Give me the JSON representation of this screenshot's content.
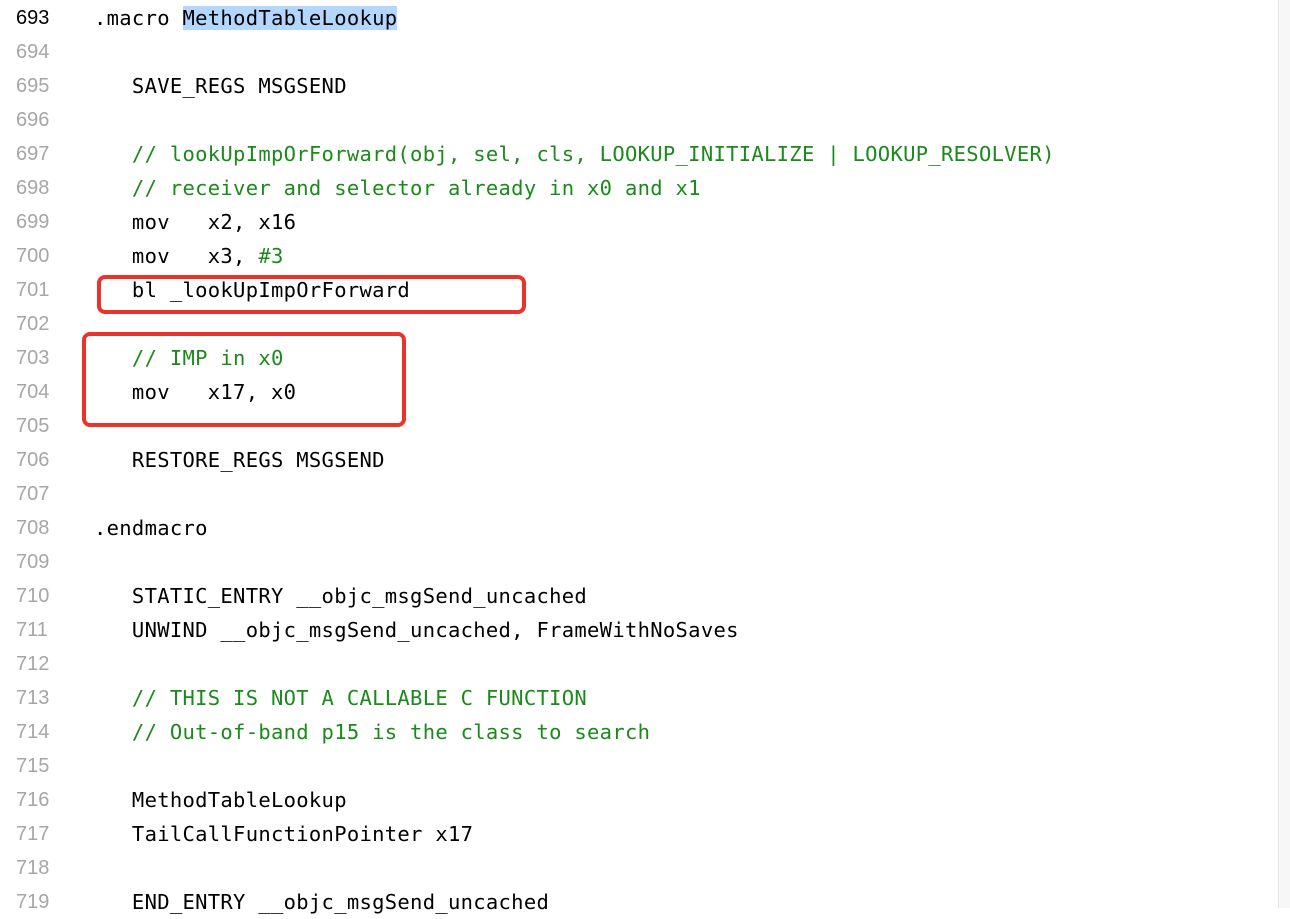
{
  "editor": {
    "current_line": 693,
    "selected_text": "MethodTableLookup",
    "highlight_color": "#e8342b",
    "comment_color": "#1a8a1a",
    "selection_color": "#b3d7ff",
    "lines": [
      {
        "n": "693",
        "pre": ".macro ",
        "sel": "MethodTableLookup",
        "text": ""
      },
      {
        "n": "694",
        "text": ""
      },
      {
        "n": "695",
        "text": "   SAVE_REGS MSGSEND"
      },
      {
        "n": "696",
        "text": ""
      },
      {
        "n": "697",
        "comment": "   // lookUpImpOrForward(obj, sel, cls, LOOKUP_INITIALIZE | LOOKUP_RESOLVER)"
      },
      {
        "n": "698",
        "comment": "   // receiver and selector already in x0 and x1"
      },
      {
        "n": "699",
        "text": "   mov   x2, x16"
      },
      {
        "n": "700",
        "text": "   mov   x3, ",
        "num": "#3"
      },
      {
        "n": "701",
        "text": "   bl _lookUpImpOrForward"
      },
      {
        "n": "702",
        "text": ""
      },
      {
        "n": "703",
        "comment": "   // IMP in x0"
      },
      {
        "n": "704",
        "text": "   mov   x17, x0"
      },
      {
        "n": "705",
        "text": ""
      },
      {
        "n": "706",
        "text": "   RESTORE_REGS MSGSEND"
      },
      {
        "n": "707",
        "text": ""
      },
      {
        "n": "708",
        "text": ".endmacro"
      },
      {
        "n": "709",
        "text": ""
      },
      {
        "n": "710",
        "text": "   STATIC_ENTRY __objc_msgSend_uncached"
      },
      {
        "n": "711",
        "text": "   UNWIND __objc_msgSend_uncached, FrameWithNoSaves"
      },
      {
        "n": "712",
        "text": ""
      },
      {
        "n": "713",
        "comment": "   // THIS IS NOT A CALLABLE C FUNCTION"
      },
      {
        "n": "714",
        "comment": "   // Out-of-band p15 is the class to search"
      },
      {
        "n": "715",
        "text": ""
      },
      {
        "n": "716",
        "text": "   MethodTableLookup"
      },
      {
        "n": "717",
        "text": "   TailCallFunctionPointer x17"
      },
      {
        "n": "718",
        "text": ""
      },
      {
        "n": "719",
        "text": "   END_ENTRY __objc_msgSend_uncached"
      }
    ]
  }
}
